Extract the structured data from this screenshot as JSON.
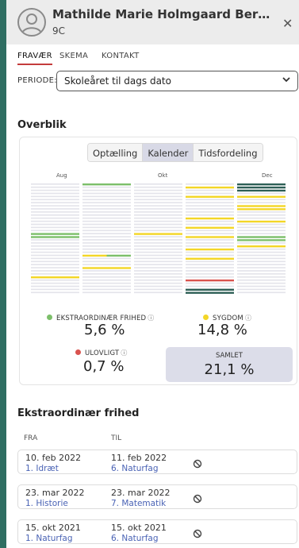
{
  "header": {
    "name": "Mathilde Marie Holmgaard Bernhoft La...",
    "class": "9C",
    "close_icon": "close-icon"
  },
  "tabs": [
    {
      "label": "FRAVÆR",
      "active": true
    },
    {
      "label": "SKEMA",
      "active": false
    },
    {
      "label": "KONTAKT",
      "active": false
    }
  ],
  "periode": {
    "label": "PERIODE:",
    "value": "Skoleåret til dags dato"
  },
  "overblik": {
    "title": "Overblik",
    "segments": [
      {
        "label": "Optælling",
        "active": false
      },
      {
        "label": "Kalender",
        "active": true
      },
      {
        "label": "Tidsfordeling",
        "active": false
      }
    ],
    "months": [
      "Aug",
      "Okt",
      "Dec"
    ],
    "colors": {
      "empty": "#e3e3ea",
      "ekstra": "#2d5f56",
      "ekstra_green": "#7cbf6a",
      "sygdom": "#f3d627",
      "ulovligt": "#d9534f"
    },
    "calendar_columns": [
      [
        "e",
        "e",
        "e",
        "e",
        "e",
        "e",
        "e",
        "e",
        "e",
        "e",
        "e",
        "e",
        "e",
        "e",
        "e",
        "e",
        "g",
        "g",
        "e",
        "e",
        "e",
        "e",
        "e",
        "e",
        "e",
        "e",
        "e",
        "e",
        "e",
        "e",
        "y",
        "e",
        "e",
        "e",
        "e",
        "e"
      ],
      [
        "g",
        "e",
        "e",
        "e",
        "e",
        "e",
        "e",
        "e",
        "e",
        "e",
        "e",
        "e",
        "e",
        "e",
        "e",
        "e",
        "e",
        "e",
        "e",
        "e",
        "e",
        "e",
        "e",
        "yg",
        "e",
        "e",
        "e",
        "y",
        "e",
        "e",
        "e",
        "e",
        "e",
        "e",
        "e",
        "e"
      ],
      [
        "e",
        "e",
        "e",
        "e",
        "e",
        "e",
        "e",
        "e",
        "e",
        "e",
        "e",
        "e",
        "e",
        "e",
        "e",
        "e",
        "y",
        "e",
        "e",
        "e",
        "e",
        "e",
        "e",
        "e",
        "e",
        "e",
        "e",
        "e",
        "e",
        "e",
        "e",
        "e",
        "e",
        "e",
        "e",
        "e"
      ],
      [
        "e",
        "y",
        "e",
        "e",
        "y",
        "e",
        "e",
        "e",
        "e",
        "e",
        "e",
        "y",
        "e",
        "e",
        "y",
        "e",
        "e",
        "y",
        "e",
        "e",
        "e",
        "y",
        "e",
        "e",
        "y",
        "e",
        "e",
        "e",
        "e",
        "e",
        "e",
        "r",
        "e",
        "e",
        "x",
        "x"
      ],
      [
        "x",
        "x",
        "x",
        "e",
        "y",
        "e",
        "e",
        "y",
        "y",
        "e",
        "e",
        "e",
        "y",
        "e",
        "e",
        "e",
        "e",
        "g",
        "g",
        "e",
        "y",
        "e",
        "e",
        "e",
        "e",
        "e",
        "e",
        "e",
        "e",
        "e",
        "e",
        "e",
        "e",
        "e",
        "e",
        "e"
      ]
    ],
    "stats": {
      "ekstraordinaer": {
        "label": "EKSTRAORDINÆR FRIHED",
        "value": "5,6 %",
        "color": "#7cbf6a"
      },
      "sygdom": {
        "label": "SYGDOM",
        "value": "14,8 %",
        "color": "#f3d627"
      },
      "ulovligt": {
        "label": "ULOVLIGT",
        "value": "0,7 %",
        "color": "#d9534f"
      },
      "samlet": {
        "label": "SAMLET",
        "value": "21,1 %"
      }
    }
  },
  "ekstraordinaer_frihed": {
    "title": "Ekstraordinær frihed",
    "columns": [
      "FRA",
      "TIL"
    ],
    "rows": [
      {
        "fra_date": "10. feb 2022",
        "fra_sub": "1. Idræt",
        "til_date": "11. feb 2022",
        "til_sub": "6. Naturfag"
      },
      {
        "fra_date": "23. mar 2022",
        "fra_sub": "1. Historie",
        "til_date": "23. mar 2022",
        "til_sub": "7. Matematik"
      },
      {
        "fra_date": "15. okt 2021",
        "fra_sub": "1. Naturfag",
        "til_date": "15. okt 2021",
        "til_sub": "6. Naturfag"
      }
    ]
  }
}
